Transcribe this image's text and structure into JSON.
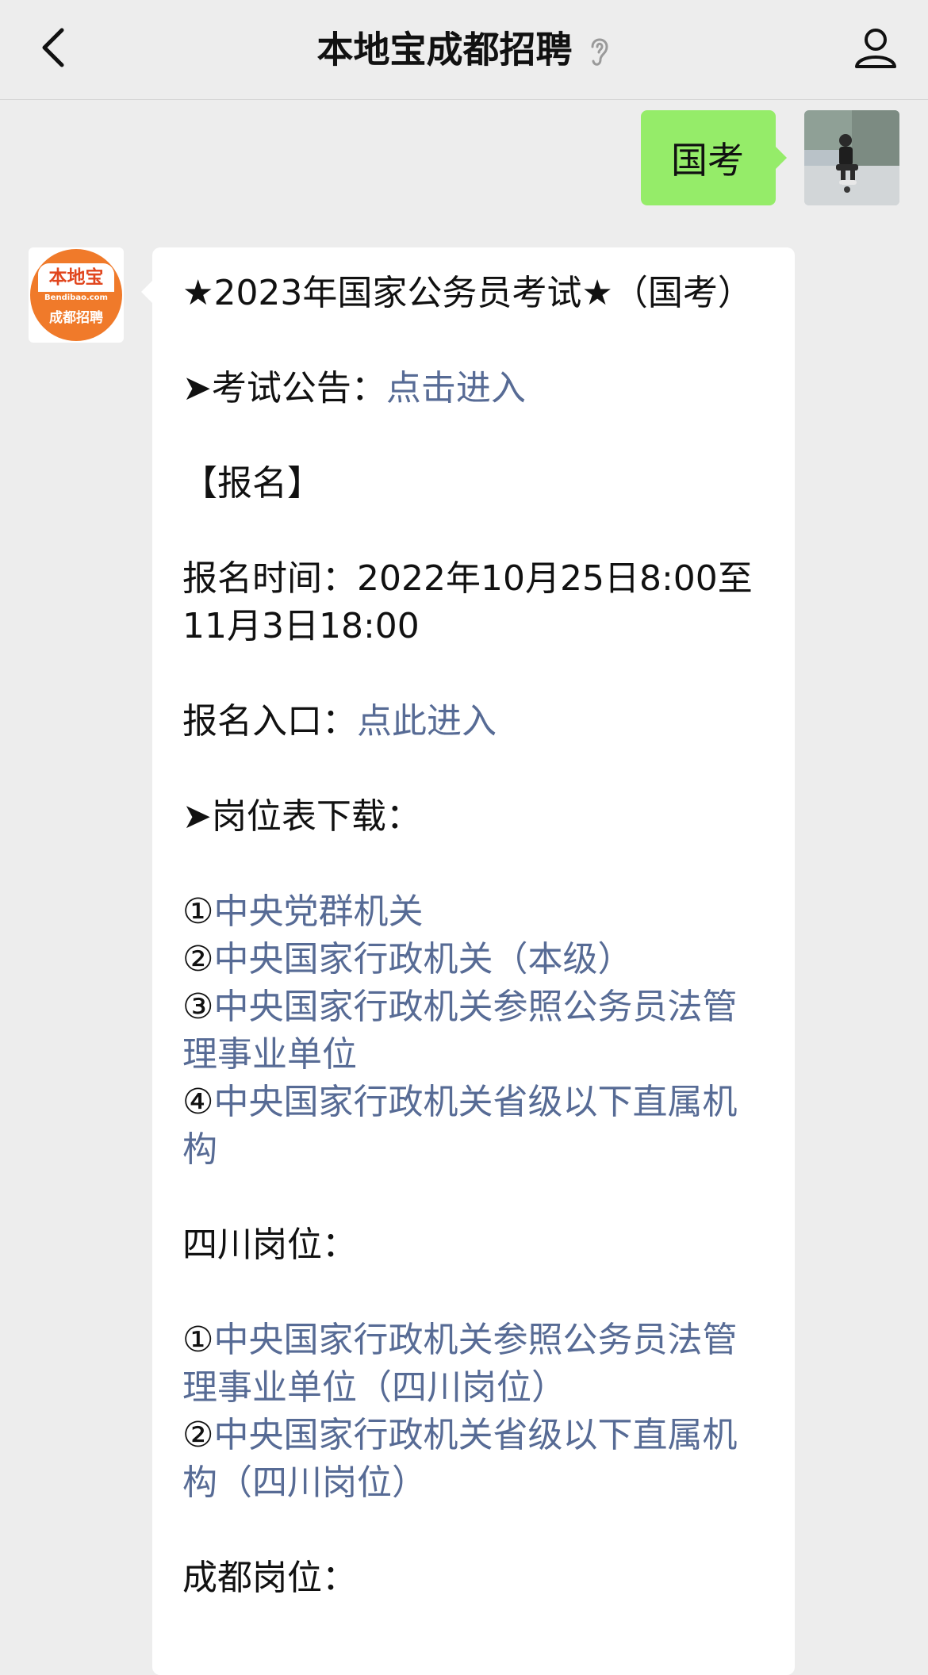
{
  "header": {
    "title": "本地宝成都招聘",
    "back_icon": "chevron-left-icon",
    "ear_icon": "ear-icon",
    "profile_icon": "person-icon"
  },
  "outgoing": {
    "text": "国考",
    "bubble_color": "#95ec69"
  },
  "bot": {
    "logo_top": "本地宝",
    "logo_sub": "Bendibao.com",
    "logo_bottom": "成都招聘",
    "logo_color": "#f07a2a"
  },
  "message": {
    "title": "★2023年国家公务员考试★（国考）",
    "notice_prefix": "➤考试公告：",
    "notice_link": "点击进入",
    "signup_heading": "【报名】",
    "signup_time": "报名时间：2022年10月25日8:00至11月3日18:00",
    "entry_prefix": "报名入口：",
    "entry_link": "点此进入",
    "download_heading": "➤岗位表下载：",
    "central": [
      {
        "num": "①",
        "text": "中央党群机关"
      },
      {
        "num": "②",
        "text": "中央国家行政机关（本级）"
      },
      {
        "num": "③",
        "text": "中央国家行政机关参照公务员法管理事业单位"
      },
      {
        "num": "④",
        "text": "中央国家行政机关省级以下直属机构"
      }
    ],
    "sichuan_heading": "四川岗位：",
    "sichuan": [
      {
        "num": "①",
        "text": "中央国家行政机关参照公务员法管理事业单位（四川岗位）"
      },
      {
        "num": "②",
        "text": "中央国家行政机关省级以下直属机构（四川岗位）"
      }
    ],
    "chengdu_heading": "成都岗位：",
    "link_color": "#576b95"
  }
}
